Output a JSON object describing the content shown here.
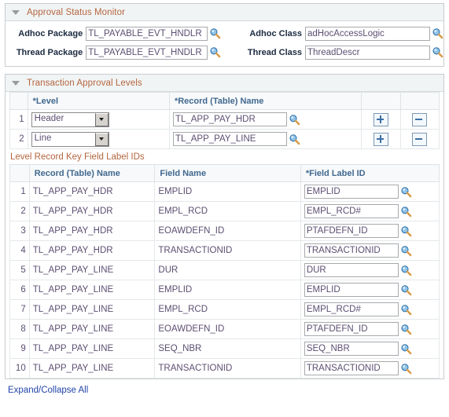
{
  "sections": {
    "approval_status_monitor": {
      "title": "Approval Status Monitor",
      "fields": {
        "adhoc_package_label": "Adhoc Package",
        "adhoc_package_value": "TL_PAYABLE_EVT_HNDLR",
        "adhoc_class_label": "Adhoc Class",
        "adhoc_class_value": "adHocAccessLogic",
        "thread_package_label": "Thread Package",
        "thread_package_value": "TL_PAYABLE_EVT_HNDLR",
        "thread_class_label": "Thread Class",
        "thread_class_value": "ThreadDescr"
      }
    },
    "transaction_approval_levels": {
      "title": "Transaction Approval Levels",
      "columns": [
        "",
        "*Level",
        "*Record (Table) Name",
        "",
        ""
      ],
      "rows": [
        {
          "num": "1",
          "level": "Header",
          "record": "TL_APP_PAY_HDR",
          "add": "+",
          "remove": "−"
        },
        {
          "num": "2",
          "level": "Line",
          "record": "TL_APP_PAY_LINE",
          "add": "+",
          "remove": "−"
        }
      ],
      "level_options": [
        "Header",
        "Line"
      ]
    },
    "level_record_key_field_label_ids": {
      "title": "Level Record Key Field Label IDs",
      "columns": [
        "",
        "Record (Table) Name",
        "Field Name",
        "*Field Label ID"
      ],
      "rows": [
        {
          "num": "1",
          "record": "TL_APP_PAY_HDR",
          "field": "EMPLID",
          "label_id": "EMPLID"
        },
        {
          "num": "2",
          "record": "TL_APP_PAY_HDR",
          "field": "EMPL_RCD",
          "label_id": "EMPL_RCD#"
        },
        {
          "num": "3",
          "record": "TL_APP_PAY_HDR",
          "field": "EOAWDEFN_ID",
          "label_id": "PTAFDEFN_ID"
        },
        {
          "num": "4",
          "record": "TL_APP_PAY_HDR",
          "field": "TRANSACTIONID",
          "label_id": "TRANSACTIONID"
        },
        {
          "num": "5",
          "record": "TL_APP_PAY_LINE",
          "field": "DUR",
          "label_id": "DUR"
        },
        {
          "num": "6",
          "record": "TL_APP_PAY_LINE",
          "field": "EMPLID",
          "label_id": "EMPLID"
        },
        {
          "num": "7",
          "record": "TL_APP_PAY_LINE",
          "field": "EMPL_RCD",
          "label_id": "EMPL_RCD#"
        },
        {
          "num": "8",
          "record": "TL_APP_PAY_LINE",
          "field": "EOAWDEFN_ID",
          "label_id": "PTAFDEFN_ID"
        },
        {
          "num": "9",
          "record": "TL_APP_PAY_LINE",
          "field": "SEQ_NBR",
          "label_id": "SEQ_NBR"
        },
        {
          "num": "10",
          "record": "TL_APP_PAY_LINE",
          "field": "TRANSACTIONID",
          "label_id": "TRANSACTIONID"
        }
      ]
    }
  },
  "footer": {
    "expand_collapse_label": "Expand/Collapse All"
  },
  "icons": {
    "lookup": "lookup-magnifier-icon",
    "collapse": "collapse-triangle-icon"
  },
  "colors": {
    "section_title": "#b4663f",
    "column_header": "#41688f",
    "field_text": "#5c4f72",
    "link": "#2244aa",
    "button_glyph": "#3d6fa5"
  }
}
